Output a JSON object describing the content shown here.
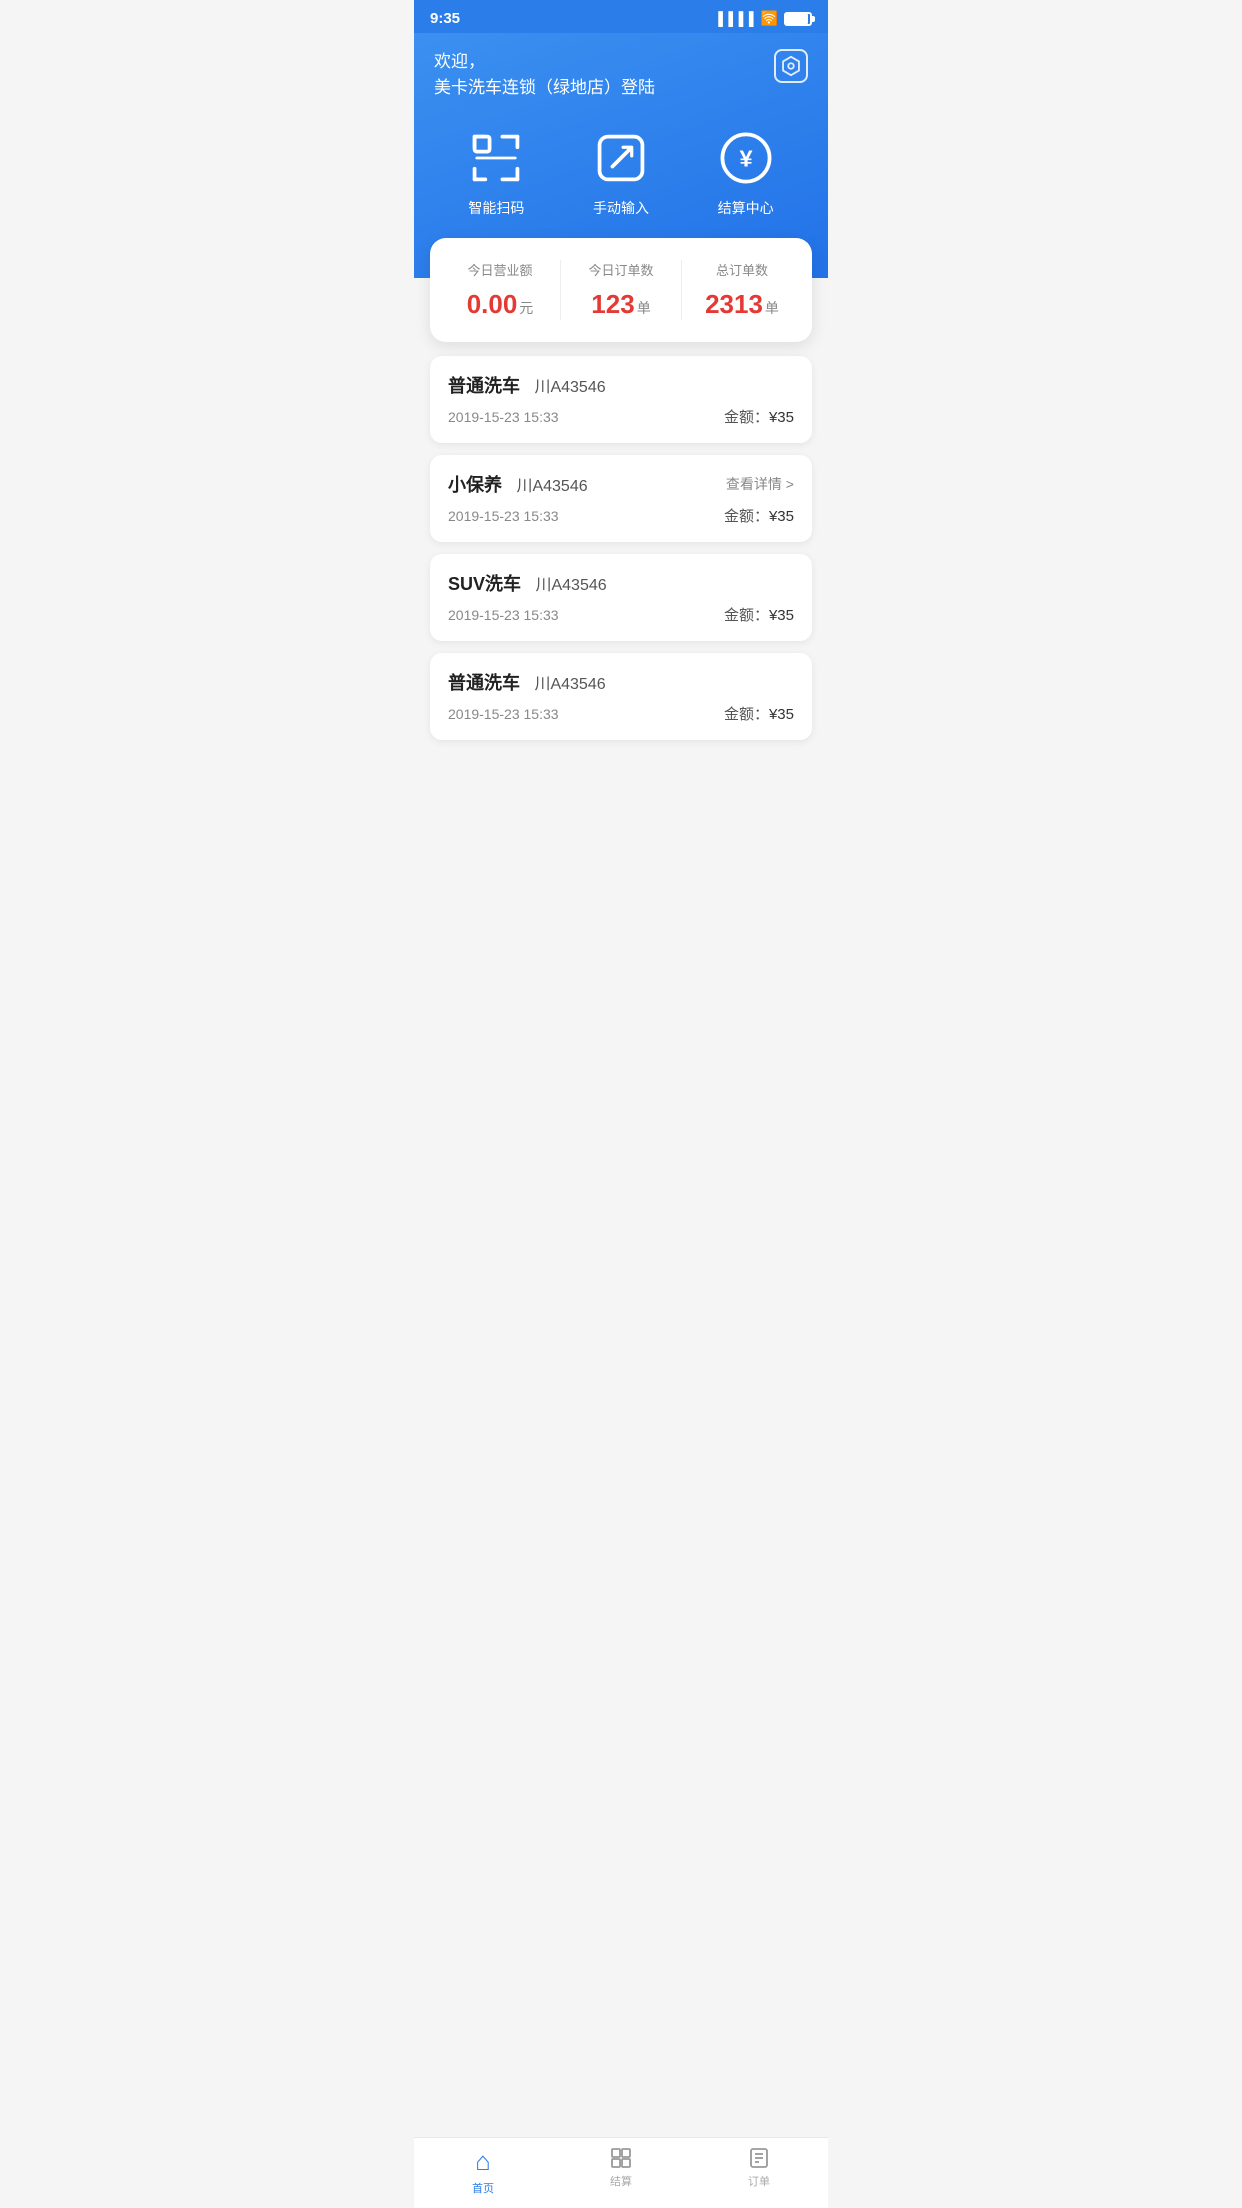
{
  "statusBar": {
    "time": "9:35"
  },
  "header": {
    "welcomeLine1": "欢迎，",
    "welcomeLine2": "美卡洗车连锁（绿地店）登陆"
  },
  "actions": [
    {
      "id": "scan",
      "label": "智能扫码",
      "type": "scan"
    },
    {
      "id": "edit",
      "label": "手动输入",
      "type": "edit"
    },
    {
      "id": "yuan",
      "label": "结算中心",
      "type": "yuan"
    }
  ],
  "stats": {
    "today_revenue_label": "今日营业额",
    "today_revenue_value": "0.00",
    "today_revenue_unit": "元",
    "today_orders_label": "今日订单数",
    "today_orders_value": "123",
    "today_orders_unit": "单",
    "total_orders_label": "总订单数",
    "total_orders_value": "2313",
    "total_orders_unit": "单"
  },
  "orders": [
    {
      "type": "普通洗车",
      "plate": "川A43546",
      "time": "2019-15-23 15:33",
      "amount": "¥35",
      "showDetail": false,
      "detailLabel": ""
    },
    {
      "type": "小保养",
      "plate": "川A43546",
      "time": "2019-15-23 15:33",
      "amount": "¥35",
      "showDetail": true,
      "detailLabel": "查看详情 >"
    },
    {
      "type": "SUV洗车",
      "plate": "川A43546",
      "time": "2019-15-23 15:33",
      "amount": "¥35",
      "showDetail": false,
      "detailLabel": ""
    },
    {
      "type": "普通洗车",
      "plate": "川A43546",
      "time": "2019-15-23 15:33",
      "amount": "¥35",
      "showDetail": false,
      "detailLabel": ""
    }
  ],
  "bottomNav": [
    {
      "id": "home",
      "label": "首页",
      "active": true
    },
    {
      "id": "checkout",
      "label": "结算",
      "active": false
    },
    {
      "id": "orders",
      "label": "订单",
      "active": false
    }
  ],
  "amountLabel": "金额："
}
